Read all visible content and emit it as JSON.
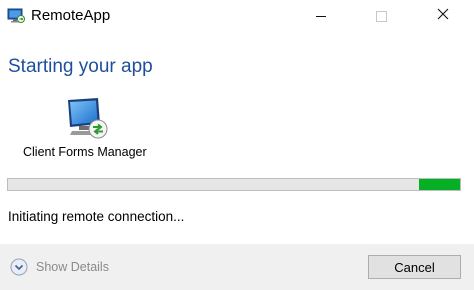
{
  "window": {
    "title": "RemoteApp",
    "controls": {
      "minimize_icon": "minimize-icon",
      "maximize_icon": "maximize-icon",
      "close_icon": "close-icon"
    }
  },
  "main": {
    "heading": "Starting your app",
    "program": {
      "name": "Client Forms Manager",
      "icon": "remote-computer-icon"
    },
    "progress": {
      "value_fraction": 0.09,
      "style": "marquee-chunk-at-end",
      "color": "#06b025"
    },
    "status": "Initiating remote connection..."
  },
  "footer": {
    "details_label": "Show Details",
    "details_icon": "chevron-down-circle-icon",
    "cancel_label": "Cancel"
  },
  "colors": {
    "heading": "#1f4f9c",
    "progress": "#06b025",
    "footer_bg": "#f0f0f0"
  }
}
